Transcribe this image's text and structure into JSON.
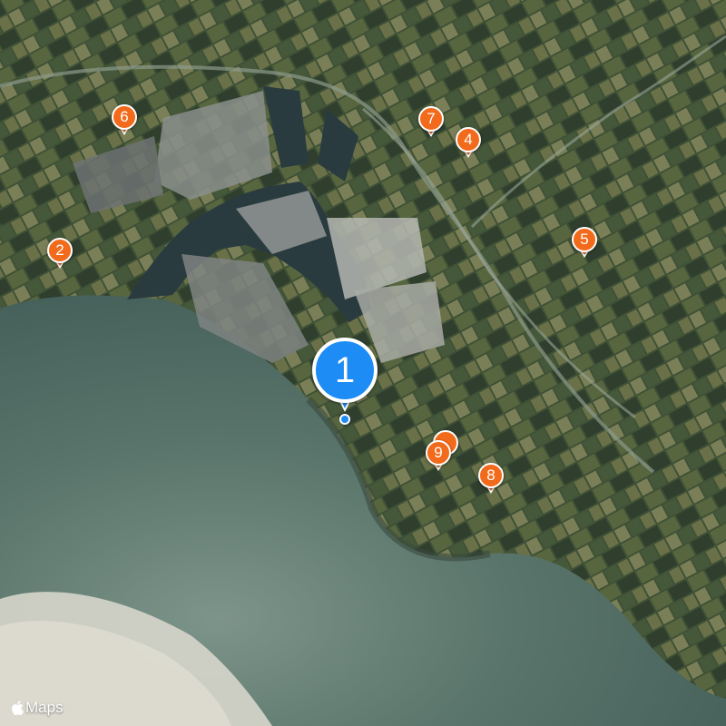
{
  "map": {
    "type": "satellite",
    "colors": {
      "sea": "#4f6b63",
      "sea_light": "#7d948a",
      "sand": "#d7d6cb",
      "land": "#3d5137",
      "field_a": "#58663f",
      "field_b": "#2f3e2d",
      "field_c": "#8a8a62",
      "port_water": "#2a3b40",
      "industry": "#8a8f8c"
    }
  },
  "markers": [
    {
      "label": "1",
      "style": "primary",
      "color": "#1d8cf5"
    },
    {
      "label": "2",
      "style": "secondary",
      "color": "#f26a1b"
    },
    {
      "label": "4",
      "style": "secondary",
      "color": "#f26a1b"
    },
    {
      "label": "5",
      "style": "secondary",
      "color": "#f26a1b"
    },
    {
      "label": "6",
      "style": "secondary",
      "color": "#f26a1b"
    },
    {
      "label": "7",
      "style": "secondary",
      "color": "#f26a1b"
    },
    {
      "label": "8",
      "style": "secondary",
      "color": "#f26a1b"
    },
    {
      "label": "9",
      "style": "secondary",
      "color": "#f26a1b"
    }
  ],
  "attribution": {
    "brand_label": "Maps",
    "icon": "apple-logo-icon"
  }
}
